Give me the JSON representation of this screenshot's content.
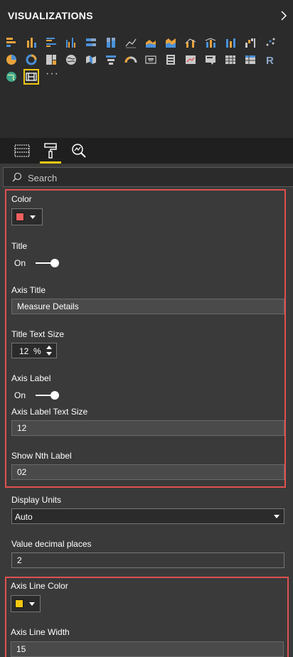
{
  "header": {
    "title": "VISUALIZATIONS",
    "chevron_icon": "chevron-right-icon"
  },
  "colors": {
    "panel_bg": "#3a3a3a",
    "header_bg": "#2b2b2b",
    "accent": "#f2c811",
    "highlight": "#e05050",
    "title_color_swatch": "#f06060",
    "axis_line_color_swatch": "#f2c811"
  },
  "gallery": {
    "icons": [
      "stacked-bar-chart-icon",
      "stacked-column-chart-icon",
      "clustered-bar-chart-icon",
      "clustered-column-chart-icon",
      "100-percent-stacked-bar-icon",
      "100-percent-stacked-column-icon",
      "line-chart-icon",
      "area-chart-icon",
      "stacked-area-chart-icon",
      "line-and-column-chart-icon",
      "line-and-stacked-column-icon",
      "ribbon-chart-icon",
      "waterfall-chart-icon",
      "scatter-chart-icon",
      "pie-chart-icon",
      "donut-chart-icon",
      "treemap-icon",
      "map-icon",
      "filled-map-icon",
      "funnel-icon",
      "gauge-icon",
      "card-icon",
      "multi-row-card-icon",
      "kpi-icon",
      "slicer-icon",
      "table-icon",
      "matrix-icon",
      "r-script-icon",
      "globe-map-icon",
      "custom-visual-icon"
    ],
    "more_icon": "more-icon"
  },
  "tabs": [
    {
      "name": "fields-tab",
      "icon": "fields-icon",
      "active": false
    },
    {
      "name": "format-tab",
      "icon": "paint-roller-icon",
      "active": true
    },
    {
      "name": "analytics-tab",
      "icon": "analytics-icon",
      "active": false
    }
  ],
  "search": {
    "placeholder": "Search",
    "value": ""
  },
  "format": {
    "color_label": "Color",
    "title_label": "Title",
    "title_toggle": "On",
    "axis_title_label": "Axis Title",
    "axis_title_value": "Measure Details",
    "title_text_size_label": "Title Text Size",
    "title_text_size_value": "12",
    "title_text_size_unit": "%",
    "axis_label_label": "Axis Label",
    "axis_label_toggle": "On",
    "axis_label_text_size_label": "Axis Label Text Size",
    "axis_label_text_size_value": "12",
    "show_nth_label_label": "Show Nth Label",
    "show_nth_label_value": "02",
    "display_units_label": "Display Units",
    "display_units_value": "Auto",
    "value_decimal_places_label": "Value decimal places",
    "value_decimal_places_value": "2",
    "axis_line_color_label": "Axis Line Color",
    "axis_line_width_label": "Axis Line Width",
    "axis_line_width_value": "15"
  }
}
